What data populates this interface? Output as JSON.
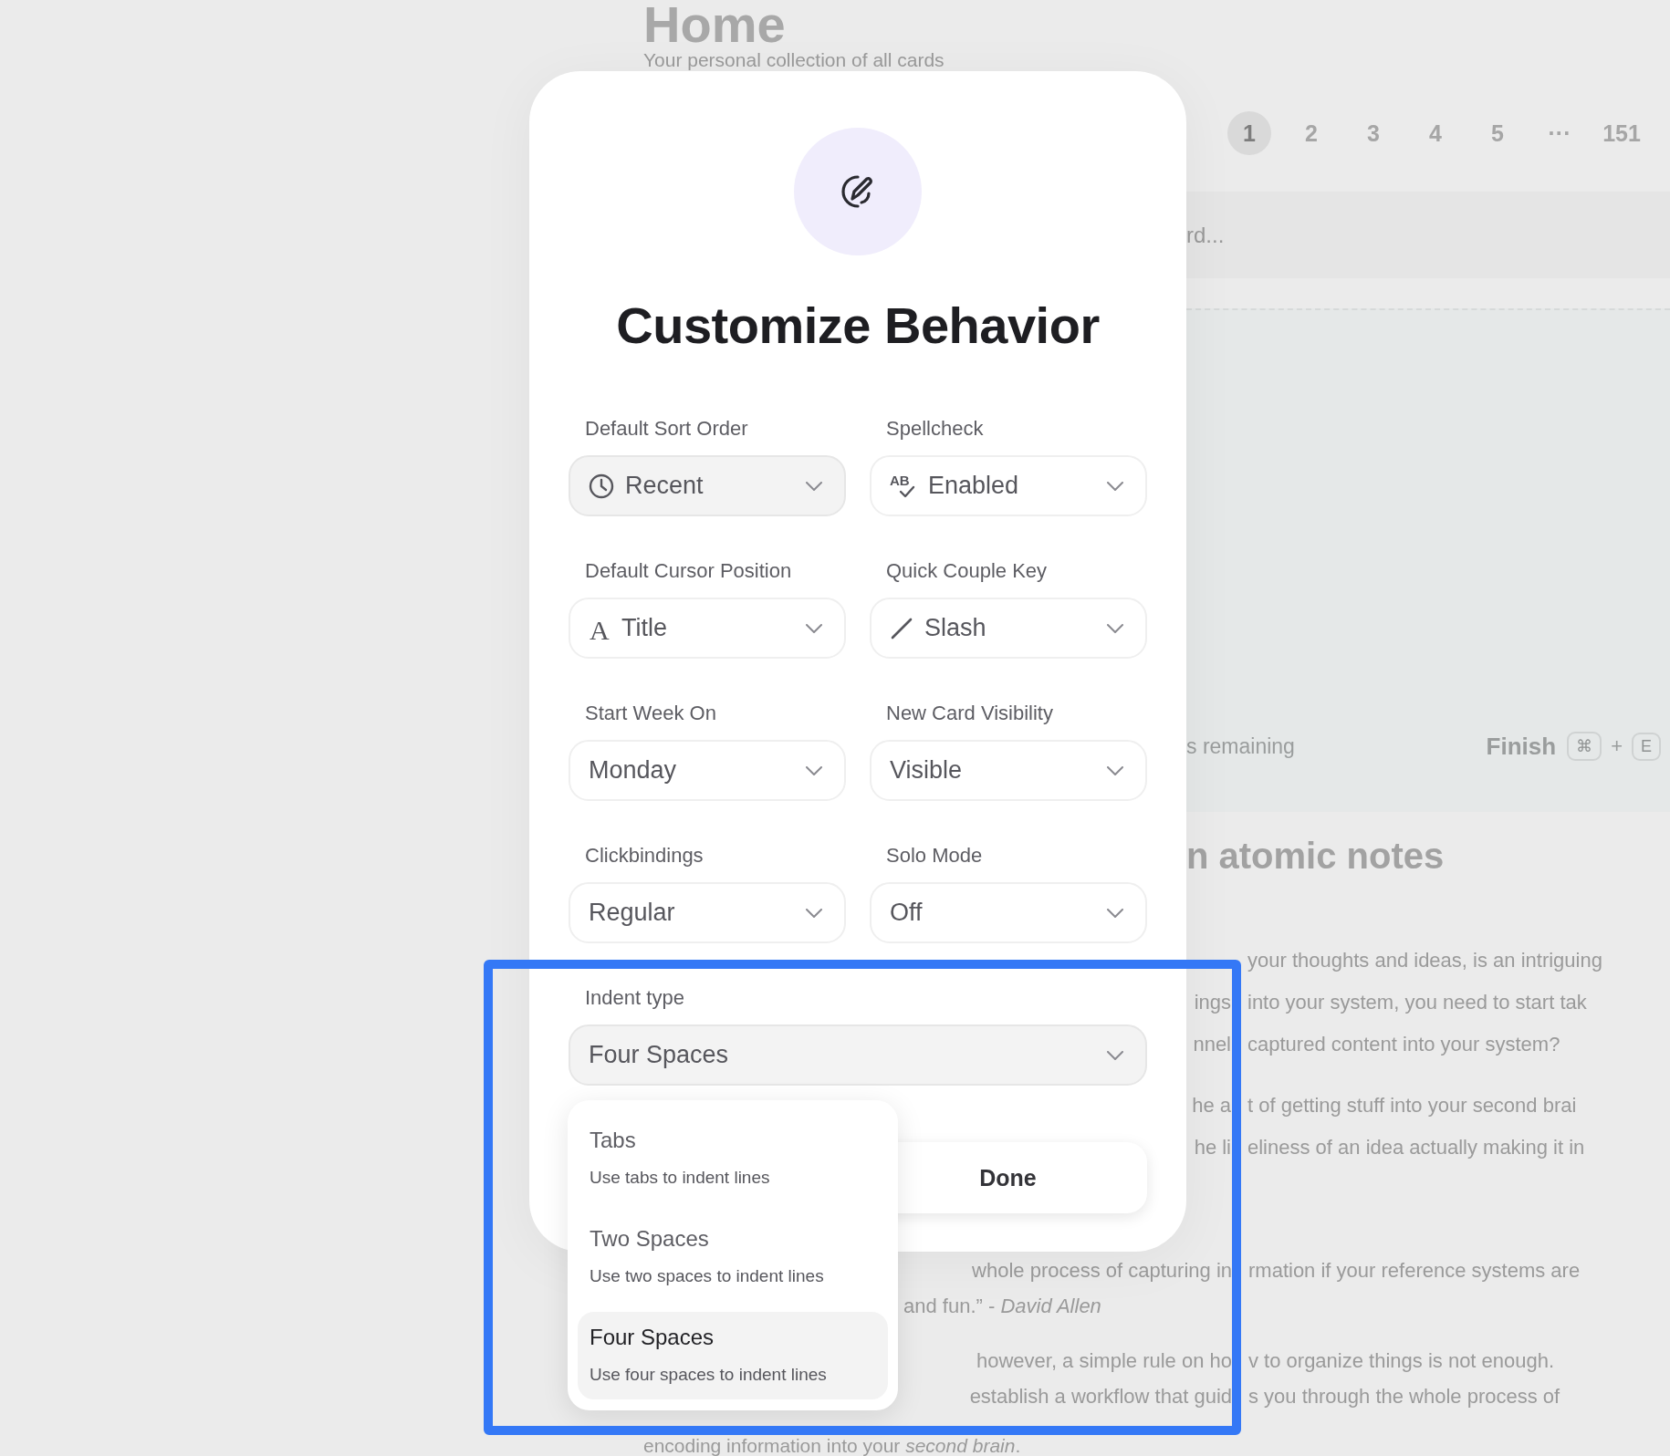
{
  "background": {
    "title": "Home",
    "subtitle": "Your personal collection of all cards",
    "pages": [
      {
        "label": "1",
        "selected": true
      },
      {
        "label": "2",
        "selected": false
      },
      {
        "label": "3",
        "selected": false
      },
      {
        "label": "4",
        "selected": false
      },
      {
        "label": "5",
        "selected": false
      },
      {
        "label": "···",
        "selected": false
      },
      {
        "label": "151",
        "selected": false
      }
    ],
    "search_fragment": "rd...",
    "card": {
      "remaining": "s remaining",
      "finish": "Finish",
      "keys": [
        "⌘",
        "E"
      ],
      "plus": "+"
    },
    "heading": "n atomic notes",
    "side_lines": [
      {
        "after": "your thoughts and ideas, is an intriguing"
      },
      {
        "before": "ings",
        "after": "into your system, you need to start tak"
      },
      {
        "before": "nnel",
        "after": "captured content into your system?"
      },
      {
        "before": "he a",
        "after": "t of getting stuff into your second brai"
      },
      {
        "before": "he li",
        "after": "eliness of an idea actually making it in"
      }
    ],
    "lower_lines": [
      {
        "before": "whole process of capturing in",
        "after": "rmation if your reference systems are"
      },
      {
        "before": "and fun.” - *David Allen*"
      },
      {
        "before": "however, a simple rule on ho",
        "after": "v to organize things is not enough."
      },
      {
        "before": "establish a workflow that guid",
        "after": "s you through the whole process of"
      }
    ],
    "last_line": "encoding information into your *second brain*."
  },
  "dialog": {
    "title": "Customize Behavior",
    "fields": [
      {
        "label": "Default Sort Order",
        "value": "Recent",
        "kind": "clock",
        "active": true
      },
      {
        "label": "Spellcheck",
        "value": "Enabled",
        "kind": "spellcheck",
        "icon_text": "AB",
        "active": false
      },
      {
        "label": "Default Cursor Position",
        "value": "Title",
        "kind": "letter",
        "icon_text": "A",
        "active": false
      },
      {
        "label": "Quick Couple Key",
        "value": "Slash",
        "kind": "slash",
        "active": false
      },
      {
        "label": "Start Week On",
        "value": "Monday",
        "kind": "plain",
        "active": false
      },
      {
        "label": "New Card Visibility",
        "value": "Visible",
        "kind": "plain",
        "active": false
      },
      {
        "label": "Clickbindings",
        "value": "Regular",
        "kind": "plain",
        "active": false
      },
      {
        "label": "Solo Mode",
        "value": "Off",
        "kind": "plain",
        "active": false
      }
    ],
    "indent": {
      "label": "Indent type",
      "value": "Four Spaces",
      "active": true
    },
    "done": "Done",
    "options": [
      {
        "title": "Tabs",
        "description": "Use tabs to indent lines",
        "selected": false
      },
      {
        "title": "Two Spaces",
        "description": "Use two spaces to indent lines",
        "selected": false
      },
      {
        "title": "Four Spaces",
        "description": "Use four spaces to indent lines",
        "selected": true
      }
    ]
  }
}
